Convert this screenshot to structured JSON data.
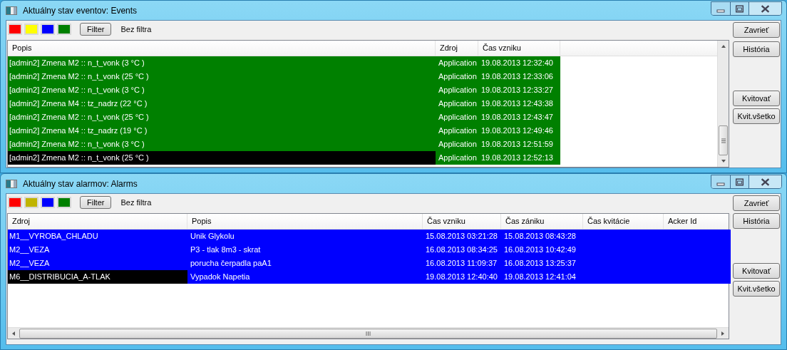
{
  "windows": [
    {
      "title": "Aktuálny stav eventov: Events",
      "swatches": [
        {
          "color": "#ff0000"
        },
        {
          "color": "#ffff00"
        },
        {
          "color": "#0000ff"
        },
        {
          "color": "#008000"
        }
      ],
      "filter_button": "Filter",
      "filter_status": "Bez filtra",
      "columns": [
        "Popis",
        "Zdroj",
        "Čas vzniku"
      ],
      "rows": [
        {
          "color": "#008000",
          "selected": false,
          "cells": [
            "[admin2] Zmena M2 :: n_t_vonk (3 °C )",
            "Application",
            "19.08.2013 12:32:40"
          ]
        },
        {
          "color": "#008000",
          "selected": false,
          "cells": [
            "[admin2] Zmena M2 :: n_t_vonk (25 °C )",
            "Application",
            "19.08.2013 12:33:06"
          ]
        },
        {
          "color": "#008000",
          "selected": false,
          "cells": [
            "[admin2] Zmena M2 :: n_t_vonk (3 °C )",
            "Application",
            "19.08.2013 12:33:27"
          ]
        },
        {
          "color": "#008000",
          "selected": false,
          "cells": [
            "[admin2] Zmena M4 :: tz_nadrz (22 °C )",
            "Application",
            "19.08.2013 12:43:38"
          ]
        },
        {
          "color": "#008000",
          "selected": false,
          "cells": [
            "[admin2] Zmena M2 :: n_t_vonk (25 °C )",
            "Application",
            "19.08.2013 12:43:47"
          ]
        },
        {
          "color": "#008000",
          "selected": false,
          "cells": [
            "[admin2] Zmena M4 :: tz_nadrz (19 °C )",
            "Application",
            "19.08.2013 12:49:46"
          ]
        },
        {
          "color": "#008000",
          "selected": false,
          "cells": [
            "[admin2] Zmena M2 :: n_t_vonk (3 °C )",
            "Application",
            "19.08.2013 12:51:59"
          ]
        },
        {
          "color": "#008000",
          "selected": true,
          "cells": [
            "[admin2] Zmena M2 :: n_t_vonk (25 °C )",
            "Application",
            "19.08.2013 12:52:13"
          ]
        }
      ],
      "buttons": [
        "Zavrieť",
        "História",
        "Kvitovať",
        "Kvit.všetko"
      ]
    },
    {
      "title": "Aktuálny stav alarmov: Alarms",
      "swatches": [
        {
          "color": "#ff0000"
        },
        {
          "color": "#c0b400"
        },
        {
          "color": "#0000ff"
        },
        {
          "color": "#008000"
        }
      ],
      "filter_button": "Filter",
      "filter_status": "Bez filtra",
      "columns": [
        "Zdroj",
        "Popis",
        "Čas vzniku",
        "Čas zániku",
        "Čas kvitácie",
        "Acker Id"
      ],
      "rows": [
        {
          "color": "#0000ff",
          "selected": false,
          "cells": [
            "M1__VYROBA_CHLADU",
            "Unik Glykolu",
            "15.08.2013 03:21:28",
            "15.08.2013 08:43:28"
          ]
        },
        {
          "color": "#0000ff",
          "selected": false,
          "cells": [
            "M2__VEZA",
            "P3 - tlak 8m3 - skrat",
            "16.08.2013 08:34:25",
            "16.08.2013 10:42:49"
          ]
        },
        {
          "color": "#0000ff",
          "selected": false,
          "cells": [
            "M2__VEZA",
            "porucha čerpadla paA1",
            "16.08.2013 11:09:37",
            "16.08.2013 13:25:37"
          ]
        },
        {
          "color": "#0000ff",
          "selected": true,
          "cells": [
            "M6__DISTRIBUCIA_A-TLAK",
            "Vypadok Napetia",
            "19.08.2013 12:40:40",
            "19.08.2013 12:41:04"
          ]
        }
      ],
      "buttons": [
        "Zavrieť",
        "História",
        "Kvitovať",
        "Kvit.všetko"
      ]
    }
  ]
}
